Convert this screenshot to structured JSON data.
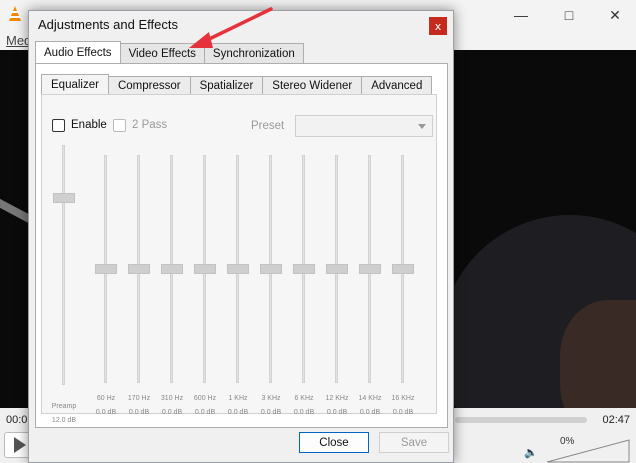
{
  "background_player": {
    "menu_label": "Med",
    "time_elapsed": "00:0",
    "time_total": "02:47",
    "volume": "0%"
  },
  "dialog": {
    "title": "Adjustments and Effects",
    "close_glyph": "x",
    "main_tabs": [
      "Audio Effects",
      "Video Effects",
      "Synchronization"
    ],
    "active_main_tab": "Audio Effects",
    "sub_tabs": [
      "Equalizer",
      "Compressor",
      "Spatializer",
      "Stereo Widener",
      "Advanced"
    ],
    "active_sub_tab": "Equalizer",
    "enable_label": "Enable",
    "enable_checked": false,
    "two_pass_label": "2 Pass",
    "preset_label": "Preset",
    "preset_value": "",
    "preamp": {
      "label": "Preamp",
      "value": "12.0 dB",
      "level": 0.78
    },
    "bands": [
      {
        "freq": "60 Hz",
        "gain": "0.0 dB",
        "level": 0.5
      },
      {
        "freq": "170 Hz",
        "gain": "0.0 dB",
        "level": 0.5
      },
      {
        "freq": "310 Hz",
        "gain": "0.0 dB",
        "level": 0.5
      },
      {
        "freq": "600 Hz",
        "gain": "0.0 dB",
        "level": 0.5
      },
      {
        "freq": "1 KHz",
        "gain": "0.0 dB",
        "level": 0.5
      },
      {
        "freq": "3 KHz",
        "gain": "0.0 dB",
        "level": 0.5
      },
      {
        "freq": "6 KHz",
        "gain": "0.0 dB",
        "level": 0.5
      },
      {
        "freq": "12 KHz",
        "gain": "0.0 dB",
        "level": 0.5
      },
      {
        "freq": "14 KHz",
        "gain": "0.0 dB",
        "level": 0.5
      },
      {
        "freq": "16 KHz",
        "gain": "0.0 dB",
        "level": 0.5
      }
    ],
    "buttons": {
      "close": "Close",
      "save": "Save"
    }
  },
  "colors": {
    "annotation_arrow": "#e5323b",
    "close_button": "#c42b1c",
    "primary_button_border": "#0067c0"
  }
}
